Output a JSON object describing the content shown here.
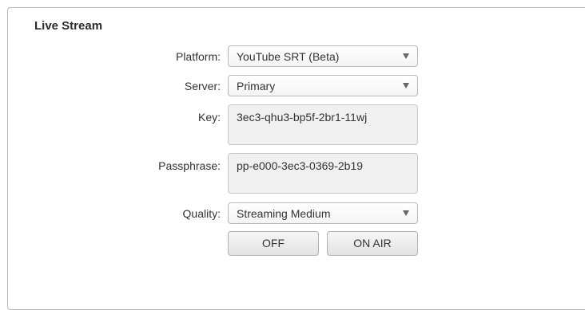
{
  "section": {
    "title": "Live Stream"
  },
  "fields": {
    "platform": {
      "label": "Platform:",
      "value": "YouTube SRT (Beta)"
    },
    "server": {
      "label": "Server:",
      "value": "Primary"
    },
    "key": {
      "label": "Key:",
      "value": "3ec3-qhu3-bp5f-2br1-11wj"
    },
    "passphrase": {
      "label": "Passphrase:",
      "value": "pp-e000-3ec3-0369-2b19"
    },
    "quality": {
      "label": "Quality:",
      "value": "Streaming Medium"
    }
  },
  "buttons": {
    "off": "OFF",
    "on_air": "ON AIR"
  },
  "icons": {
    "dropdown": "chevron-down-icon"
  },
  "colors": {
    "border": "#b9b9b9",
    "text": "#333333",
    "field_background": "#f0f0f0"
  }
}
